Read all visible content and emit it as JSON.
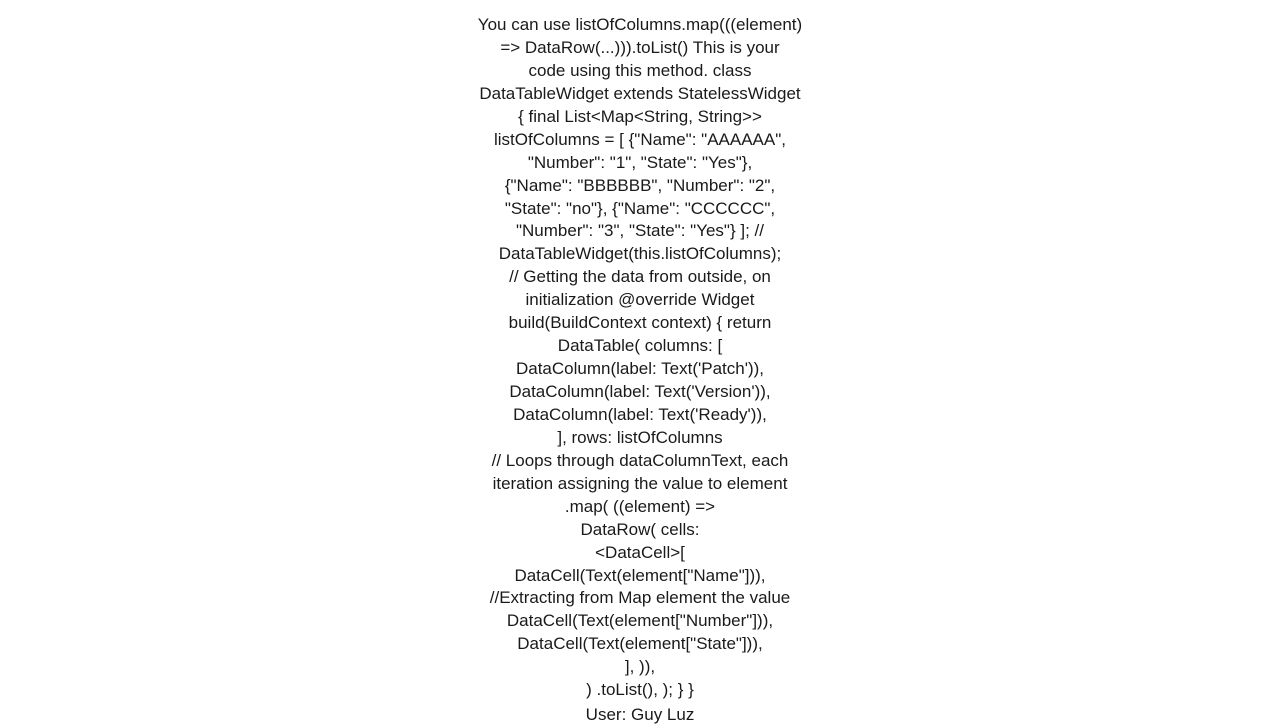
{
  "answer": {
    "lines": [
      "You can use listOfColumns.map(((element)",
      "=> DataRow(...))).toList()  This is your",
      "code using this method. class",
      "DataTableWidget extends StatelessWidget",
      "{   final List<Map<String, String>>",
      "listOfColumns = [     {\"Name\": \"AAAAAA\",",
      "\"Number\": \"1\", \"State\": \"Yes\"},",
      "{\"Name\": \"BBBBBB\", \"Number\": \"2\",",
      "\"State\": \"no\"},     {\"Name\": \"CCCCCC\",",
      "\"Number\": \"3\", \"State\": \"Yes\"}   ]; //",
      "DataTableWidget(this.listOfColumns);",
      "// Getting the data from outside, on",
      "initialization   @override   Widget",
      "build(BuildContext context) {     return",
      "DataTable(       columns: [",
      "DataColumn(label: Text('Patch')),",
      "DataColumn(label: Text('Version')),",
      "DataColumn(label: Text('Ready')),",
      "],       rows:           listOfColumns",
      "// Loops through dataColumnText, each",
      "iteration assigning the value to element",
      ".map(                 ((element) =>",
      "DataRow(                       cells:",
      "<DataCell>[",
      "DataCell(Text(element[\"Name\"])),",
      "//Extracting from Map element the value",
      "DataCell(Text(element[\"Number\"])),",
      "DataCell(Text(element[\"State\"])),",
      "],                     )),",
      ")               .toList(),     );   } }"
    ],
    "user_label": "User: Guy Luz"
  }
}
